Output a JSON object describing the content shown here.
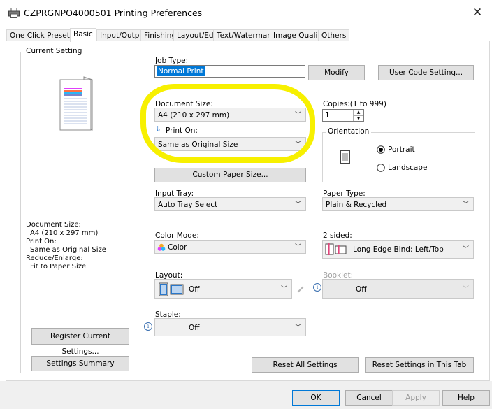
{
  "window": {
    "title": "CZPRGNPO4000501 Printing Preferences",
    "close_glyph": "✕"
  },
  "tabs": [
    {
      "label": "One Click Presets"
    },
    {
      "label": "Basic"
    },
    {
      "label": "Input/Output"
    },
    {
      "label": "Finishing"
    },
    {
      "label": "Layout/Edit"
    },
    {
      "label": "Text/Watermark"
    },
    {
      "label": "Image Quality"
    },
    {
      "label": "Others"
    }
  ],
  "current_setting": {
    "title": "Current Setting",
    "summary": [
      "Document Size:",
      "  A4 (210 x 297 mm)",
      "Print On:",
      "  Same as Original Size",
      "Reduce/Enlarge:",
      "  Fit to Paper Size"
    ],
    "register_button": "Register Current Settings...",
    "summary_button": "Settings Summary"
  },
  "job_type": {
    "label": "Job Type:",
    "value": "Normal Print",
    "modify_button": "Modify",
    "user_code_button": "User Code Setting..."
  },
  "document_size": {
    "label": "Document Size:",
    "value": "A4 (210 x 297 mm)"
  },
  "print_on": {
    "label": "Print On:",
    "value": "Same as Original Size",
    "arrow_glyph": "⇓"
  },
  "custom_paper_button": "Custom Paper Size...",
  "copies": {
    "label": "Copies:(1 to 999)",
    "value": "1"
  },
  "orientation": {
    "title": "Orientation",
    "portrait": "Portrait",
    "landscape": "Landscape",
    "selected": "portrait"
  },
  "input_tray": {
    "label": "Input Tray:",
    "value": "Auto Tray Select"
  },
  "paper_type": {
    "label": "Paper Type:",
    "value": "Plain & Recycled"
  },
  "color_mode": {
    "label": "Color Mode:",
    "value": "Color"
  },
  "two_sided": {
    "label": "2 sided:",
    "value": "Long Edge Bind: Left/Top"
  },
  "layout": {
    "label": "Layout:",
    "value": "Off"
  },
  "booklet": {
    "label": "Booklet:",
    "value": "Off"
  },
  "staple": {
    "label": "Staple:",
    "value": "Off"
  },
  "reset_all_button": "Reset All Settings",
  "reset_tab_button": "Reset Settings in This Tab",
  "dialog_buttons": {
    "ok": "OK",
    "cancel": "Cancel",
    "apply": "Apply",
    "help": "Help"
  },
  "colors": {
    "highlight": "#f7f000",
    "selection": "#0078d7",
    "button_face": "#e1e1e1"
  }
}
